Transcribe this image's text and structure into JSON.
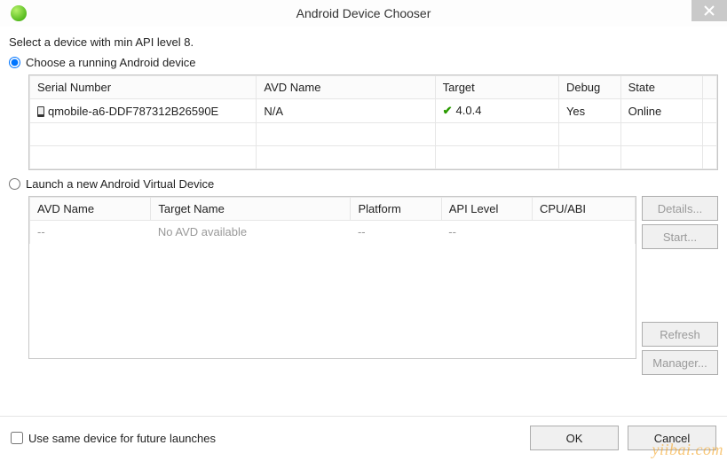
{
  "window": {
    "title": "Android Device Chooser",
    "subtitle": "Select a device with min API level 8."
  },
  "option_running": {
    "label": "Choose a running Android device",
    "selected": true,
    "columns": {
      "serial": "Serial Number",
      "avd": "AVD Name",
      "target": "Target",
      "debug": "Debug",
      "state": "State"
    },
    "rows": [
      {
        "serial": "qmobile-a6-DDF787312B26590E",
        "avd": "N/A",
        "target": "4.0.4",
        "debug": "Yes",
        "state": "Online"
      }
    ]
  },
  "option_launch": {
    "label": "Launch a new Android Virtual Device",
    "selected": false,
    "columns": {
      "avd": "AVD Name",
      "target": "Target Name",
      "platform": "Platform",
      "api": "API Level",
      "cpu": "CPU/ABI"
    },
    "rows": [
      {
        "avd": "--",
        "target": "No AVD available",
        "platform": "--",
        "api": "--",
        "cpu": ""
      }
    ],
    "buttons": {
      "details": "Details...",
      "start": "Start...",
      "refresh": "Refresh",
      "manager": "Manager..."
    }
  },
  "footer": {
    "checkbox": "Use same device for future launches",
    "checked": false,
    "ok": "OK",
    "cancel": "Cancel"
  },
  "watermark": "yiibai.com"
}
